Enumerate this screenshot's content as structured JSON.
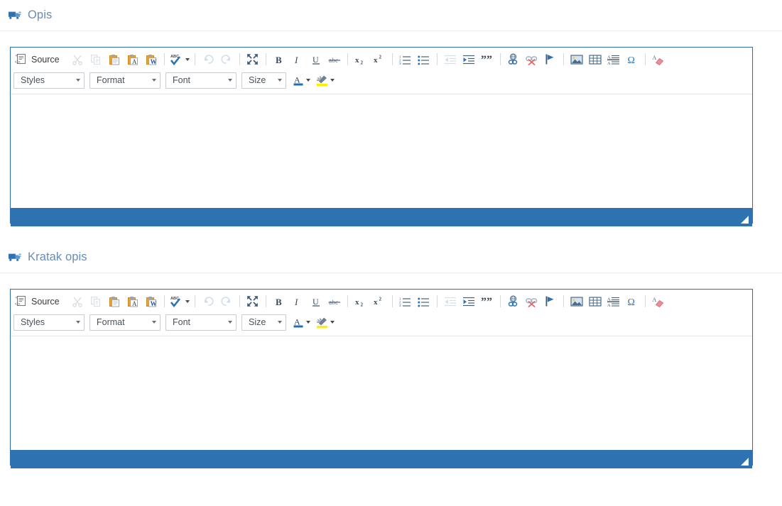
{
  "theme": {
    "accent_blue": "#2f72b2",
    "header_text": "#6a8cb5",
    "toolbar_icon": "#4b6e96",
    "border_blue": "#2f6fad",
    "divider": "#e9ecef"
  },
  "sections": [
    {
      "icon": "truck-icon",
      "title": "Opis",
      "editor": {
        "name": "description-editor",
        "content": "",
        "toolbar": {
          "source_label": "Source",
          "buttons_row1": [
            {
              "name": "source-button",
              "label": "Source",
              "disabled": false
            },
            {
              "name": "cut-button",
              "label": "Cut",
              "disabled": true
            },
            {
              "name": "copy-button",
              "label": "Copy",
              "disabled": true
            },
            {
              "name": "paste-button",
              "label": "Paste",
              "disabled": false
            },
            {
              "name": "paste-as-plain-text-button",
              "label": "Paste as plain text",
              "disabled": false
            },
            {
              "name": "paste-from-word-button",
              "label": "Paste from Word",
              "disabled": false
            },
            {
              "name": "spell-check-button",
              "label": "Spell Check As You Type",
              "disabled": false
            },
            {
              "name": "undo-button",
              "label": "Undo",
              "disabled": true
            },
            {
              "name": "redo-button",
              "label": "Redo",
              "disabled": true
            },
            {
              "name": "maximize-button",
              "label": "Maximize",
              "disabled": false
            },
            {
              "name": "bold-button",
              "label": "Bold",
              "disabled": false
            },
            {
              "name": "italic-button",
              "label": "Italic",
              "disabled": false
            },
            {
              "name": "underline-button",
              "label": "Underline",
              "disabled": false
            },
            {
              "name": "strikethrough-button",
              "label": "Strikethrough",
              "disabled": false
            },
            {
              "name": "subscript-button",
              "label": "Subscript",
              "disabled": false
            },
            {
              "name": "superscript-button",
              "label": "Superscript",
              "disabled": false
            },
            {
              "name": "numbered-list-button",
              "label": "Insert/Remove Numbered List",
              "disabled": false
            },
            {
              "name": "bulleted-list-button",
              "label": "Insert/Remove Bulleted List",
              "disabled": false
            },
            {
              "name": "decrease-indent-button",
              "label": "Decrease Indent",
              "disabled": true
            },
            {
              "name": "increase-indent-button",
              "label": "Increase Indent",
              "disabled": false
            },
            {
              "name": "blockquote-button",
              "label": "Block Quote",
              "disabled": false
            },
            {
              "name": "link-button",
              "label": "Link",
              "disabled": false
            },
            {
              "name": "unlink-button",
              "label": "Unlink",
              "disabled": false
            },
            {
              "name": "anchor-button",
              "label": "Anchor",
              "disabled": false
            },
            {
              "name": "image-button",
              "label": "Image",
              "disabled": false
            },
            {
              "name": "table-button",
              "label": "Table",
              "disabled": false
            },
            {
              "name": "horizontal-line-button",
              "label": "Insert Horizontal Line",
              "disabled": false
            },
            {
              "name": "special-character-button",
              "label": "Insert Special Character",
              "disabled": false
            },
            {
              "name": "remove-format-button",
              "label": "Remove Format",
              "disabled": false
            }
          ],
          "combos": [
            {
              "name": "styles-select",
              "value": "Styles"
            },
            {
              "name": "format-select",
              "value": "Format"
            },
            {
              "name": "font-select",
              "value": "Font"
            },
            {
              "name": "size-select",
              "value": "Size"
            }
          ],
          "color_buttons": [
            {
              "name": "text-color-button",
              "label": "Text Color",
              "swatch": "#1f6fb8"
            },
            {
              "name": "background-color-button",
              "label": "Background Color",
              "swatch": "#ffee00"
            }
          ]
        },
        "footer": {
          "resize_grip": "resize-grip"
        }
      }
    },
    {
      "icon": "truck-icon",
      "title": "Kratak opis",
      "editor": {
        "name": "short-description-editor",
        "content": "",
        "toolbar": {
          "source_label": "Source",
          "combos": [
            {
              "name": "styles-select",
              "value": "Styles"
            },
            {
              "name": "format-select",
              "value": "Format"
            },
            {
              "name": "font-select",
              "value": "Font"
            },
            {
              "name": "size-select",
              "value": "Size"
            }
          ],
          "color_buttons": [
            {
              "name": "text-color-button",
              "label": "Text Color",
              "swatch": "#1f6fb8"
            },
            {
              "name": "background-color-button",
              "label": "Background Color",
              "swatch": "#ffee00"
            }
          ]
        },
        "footer": {
          "resize_grip": "resize-grip"
        }
      }
    }
  ]
}
